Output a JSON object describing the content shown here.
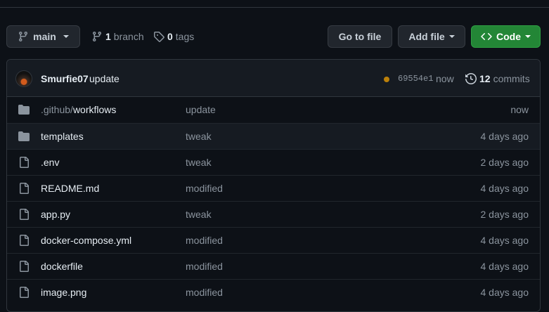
{
  "toolbar": {
    "branch_select": "main",
    "branches_count": "1",
    "branches_label": "branch",
    "tags_count": "0",
    "tags_label": "tags",
    "go_to_file": "Go to file",
    "add_file": "Add file",
    "code": "Code"
  },
  "commit": {
    "author": "Smurfie07",
    "message": "update",
    "status_color": "#bb800a",
    "sha": "69554e1",
    "time": "now",
    "commits_count": "12",
    "commits_label": "commits"
  },
  "files": [
    {
      "type": "folder",
      "dim_prefix": ".github/",
      "name": "workflows",
      "message": "update",
      "age": "now"
    },
    {
      "type": "folder",
      "dim_prefix": "",
      "name": "templates",
      "message": "tweak",
      "age": "4 days ago"
    },
    {
      "type": "file",
      "dim_prefix": "",
      "name": ".env",
      "message": "tweak",
      "age": "2 days ago"
    },
    {
      "type": "file",
      "dim_prefix": "",
      "name": "README.md",
      "message": "modified",
      "age": "4 days ago"
    },
    {
      "type": "file",
      "dim_prefix": "",
      "name": "app.py",
      "message": "tweak",
      "age": "2 days ago"
    },
    {
      "type": "file",
      "dim_prefix": "",
      "name": "docker-compose.yml",
      "message": "modified",
      "age": "4 days ago"
    },
    {
      "type": "file",
      "dim_prefix": "",
      "name": "dockerfile",
      "message": "modified",
      "age": "4 days ago"
    },
    {
      "type": "file",
      "dim_prefix": "",
      "name": "image.png",
      "message": "modified",
      "age": "4 days ago"
    }
  ]
}
